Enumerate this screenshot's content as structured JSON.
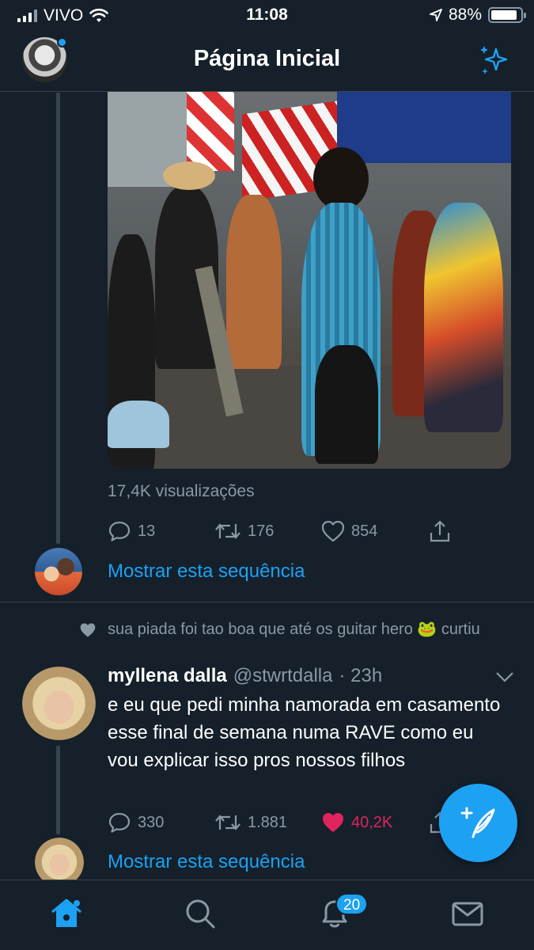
{
  "status_bar": {
    "carrier": "VIVO",
    "time": "11:08",
    "battery": "88%",
    "battery_level": 0.88
  },
  "header": {
    "title": "Página Inicial",
    "icons": {
      "avatar": "profile-avatar",
      "sparkle": "sparkle-icon"
    }
  },
  "tweet1": {
    "views": "17,4K visualizações",
    "replies": "13",
    "retweets": "176",
    "likes": "854",
    "show_thread": "Mostrar esta sequência"
  },
  "tweet2": {
    "liked_by": "sua piada foi tao boa que até os guitar hero 🐸 curtiu",
    "name": "myllena dalla",
    "handle": "@stwrtdalla",
    "time": "· 23h",
    "text": "e eu que pedi minha namorada em casamento esse final de semana numa RAVE como eu vou explicar isso pros nossos filhos",
    "replies": "330",
    "retweets": "1.881",
    "likes": "40,2K",
    "liked_state": true,
    "show_thread": "Mostrar esta sequência"
  },
  "tab_bar": {
    "notifications_badge": "20",
    "icons": [
      "home-icon",
      "search-icon",
      "bell-icon",
      "mail-icon"
    ]
  },
  "colors": {
    "background": "#15202b",
    "accent": "#1da1f2",
    "muted": "#8b98a5",
    "like": "#e0245e",
    "divider": "#38444d"
  }
}
